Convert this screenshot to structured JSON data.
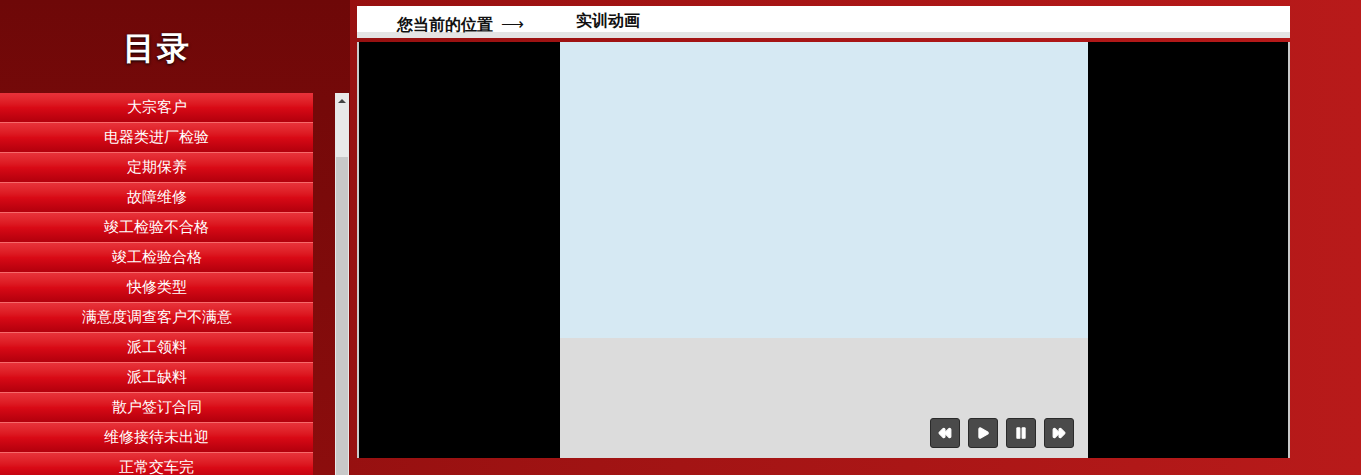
{
  "sidebar": {
    "title": "目录",
    "items": [
      {
        "label": "大宗客户",
        "selected": false
      },
      {
        "label": "电器类进厂检验",
        "selected": false
      },
      {
        "label": "定期保养",
        "selected": false
      },
      {
        "label": "故障维修",
        "selected": false
      },
      {
        "label": "竣工检验不合格",
        "selected": false
      },
      {
        "label": "竣工检验合格",
        "selected": false
      },
      {
        "label": "快修类型",
        "selected": false
      },
      {
        "label": "满意度调查客户不满意",
        "selected": false
      },
      {
        "label": "派工领料",
        "selected": false
      },
      {
        "label": "派工缺料",
        "selected": false
      },
      {
        "label": "散户签订合同",
        "selected": false
      },
      {
        "label": "维修接待未出迎",
        "selected": false
      },
      {
        "label": "正常交车完",
        "selected": false
      }
    ]
  },
  "breadcrumb": {
    "label": "您当前的位置",
    "arrow": "⟶",
    "current": "实训动画"
  },
  "player": {
    "controls": [
      {
        "kind": "rewind",
        "label": "rewind"
      },
      {
        "kind": "play",
        "label": "play"
      },
      {
        "kind": "pause",
        "label": "pause"
      },
      {
        "kind": "forward",
        "label": "forward"
      }
    ]
  }
}
